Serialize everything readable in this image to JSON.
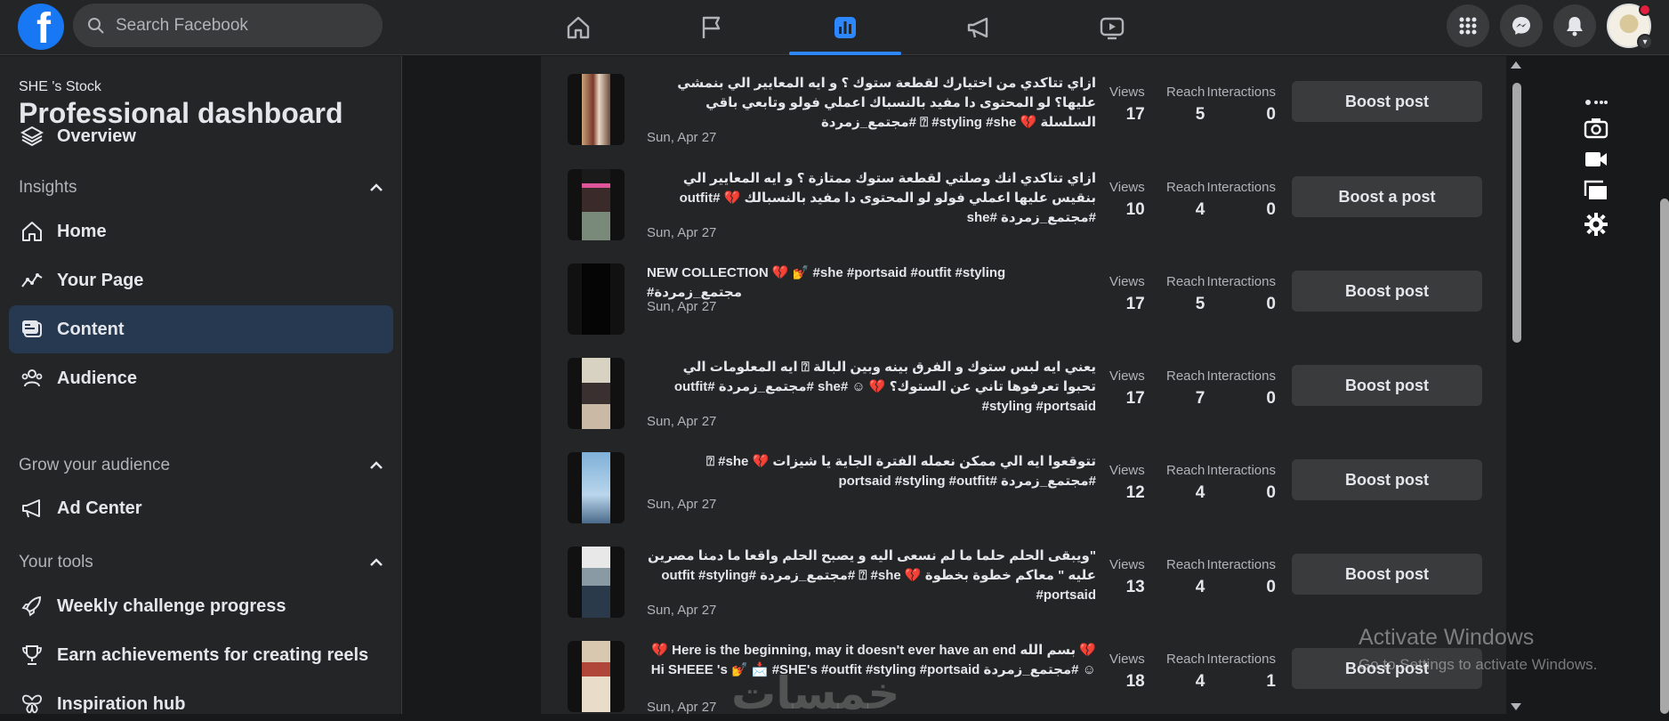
{
  "topbar": {
    "logo": "f",
    "search_placeholder": "Search Facebook",
    "nav_icons": [
      "home-icon",
      "flag-icon",
      "dashboard-icon",
      "megaphone-icon",
      "video-icon"
    ],
    "active_nav": "dashboard-icon",
    "right_icons": [
      "menu-grid-icon",
      "messenger-icon",
      "notifications-icon",
      "account-avatar"
    ]
  },
  "sidebar": {
    "page_name": "SHE 's Stock",
    "title": "Professional dashboard",
    "overview": "Overview",
    "insights": {
      "heading": "Insights",
      "items": [
        "Home",
        "Your Page",
        "Content",
        "Audience"
      ]
    },
    "grow": {
      "heading": "Grow your audience",
      "items": [
        "Ad Center"
      ]
    },
    "tools": {
      "heading": "Your tools",
      "items": [
        "Weekly challenge progress",
        "Earn achievements for creating reels",
        "Inspiration hub"
      ]
    },
    "active_item": "Content"
  },
  "content": {
    "metric_labels": {
      "views": "Views",
      "reach": "Reach",
      "interactions": "Interactions"
    },
    "posts": [
      {
        "text": "ازاي تتاكدي من اختيارك لقطعة ستوك ؟ و ايه المعايير الي بنمشي عليها؟ لو المحتوى دا مفيد بالنسباك اعملي فولو وتابعي باقي السلسلة 💔 ⍰ #styling #she #مجتمع_زمردة",
        "dir": "rtl",
        "date": "Sun, Apr 27",
        "views": "17",
        "reach": "5",
        "interactions": "0",
        "button": "Boost post"
      },
      {
        "text": "ازاي تتاكدي انك وصلتي لقطعة ستوك ممتازة ؟ و ايه المعايير الي بنقيس عليها اعملي فولو لو المحتوى دا مفيد بالنسبالك 💔 #outfit #مجتمع_زمردة #she",
        "dir": "rtl",
        "date": "Sun, Apr 27",
        "views": "10",
        "reach": "4",
        "interactions": "0",
        "button": "Boost a post"
      },
      {
        "text": "NEW COLLECTION 💔 💅 #she #portsaid #outfit #styling #مجتمع_زمردة",
        "dir": "ltr",
        "date": "Sun, Apr 27",
        "views": "17",
        "reach": "5",
        "interactions": "0",
        "button": "Boost post"
      },
      {
        "text": "يعني ايه لبس ستوك و الفرق بينه وبين البالة ⍰ ايه المعلومات الي تحبوا تعرفوها تاني عن الستوك؟ 💔 ☺ #she #مجتمع_زمردة #outfit #styling #portsaid",
        "dir": "rtl",
        "date": "Sun, Apr 27",
        "views": "17",
        "reach": "7",
        "interactions": "0",
        "button": "Boost post"
      },
      {
        "text": "تتوقعوا ايه الي ممكن نعمله الفترة الجاية يا شيزات 💔 ⍰ #she #مجتمع_زمردة #portsaid #styling #outfit",
        "dir": "rtl",
        "date": "Sun, Apr 27",
        "views": "12",
        "reach": "4",
        "interactions": "0",
        "button": "Boost post"
      },
      {
        "text": "\"ويبقى الحلم حلما ما لم نسعى اليه و يصبح الحلم واقعا ما دمنا مصرين عليه \" معاكم خطوة بخطوة 💔 ⍰ #she #مجتمع_زمردة #outfit #styling #portsaid",
        "dir": "rtl",
        "date": "Sun, Apr 27",
        "views": "13",
        "reach": "4",
        "interactions": "0",
        "button": "Boost post"
      },
      {
        "text": "💔 بسم الله Here is the beginning, may it doesn't ever have an end 💔 ☺ #مجتمع_زمردة Hi SHEEE 's 💅 📩 #SHE's #outfit #styling #portsaid",
        "dir": "rtl",
        "date": "Sun, Apr 27",
        "views": "18",
        "reach": "4",
        "interactions": "1",
        "button": "Boost post"
      }
    ]
  },
  "right_tools": [
    "camera-icon",
    "video-camera-icon",
    "copy-icon",
    "settings-gear-icon"
  ],
  "watermark": {
    "title": "Activate Windows",
    "subtitle": "Go to Settings to activate Windows.",
    "logo_text": "خمسات"
  },
  "colors": {
    "background": "#18191a",
    "surface": "#242526",
    "button": "#3a3b3c",
    "accent": "#2d88ff",
    "brand": "#1877f2",
    "active_sidebar": "#263951"
  }
}
